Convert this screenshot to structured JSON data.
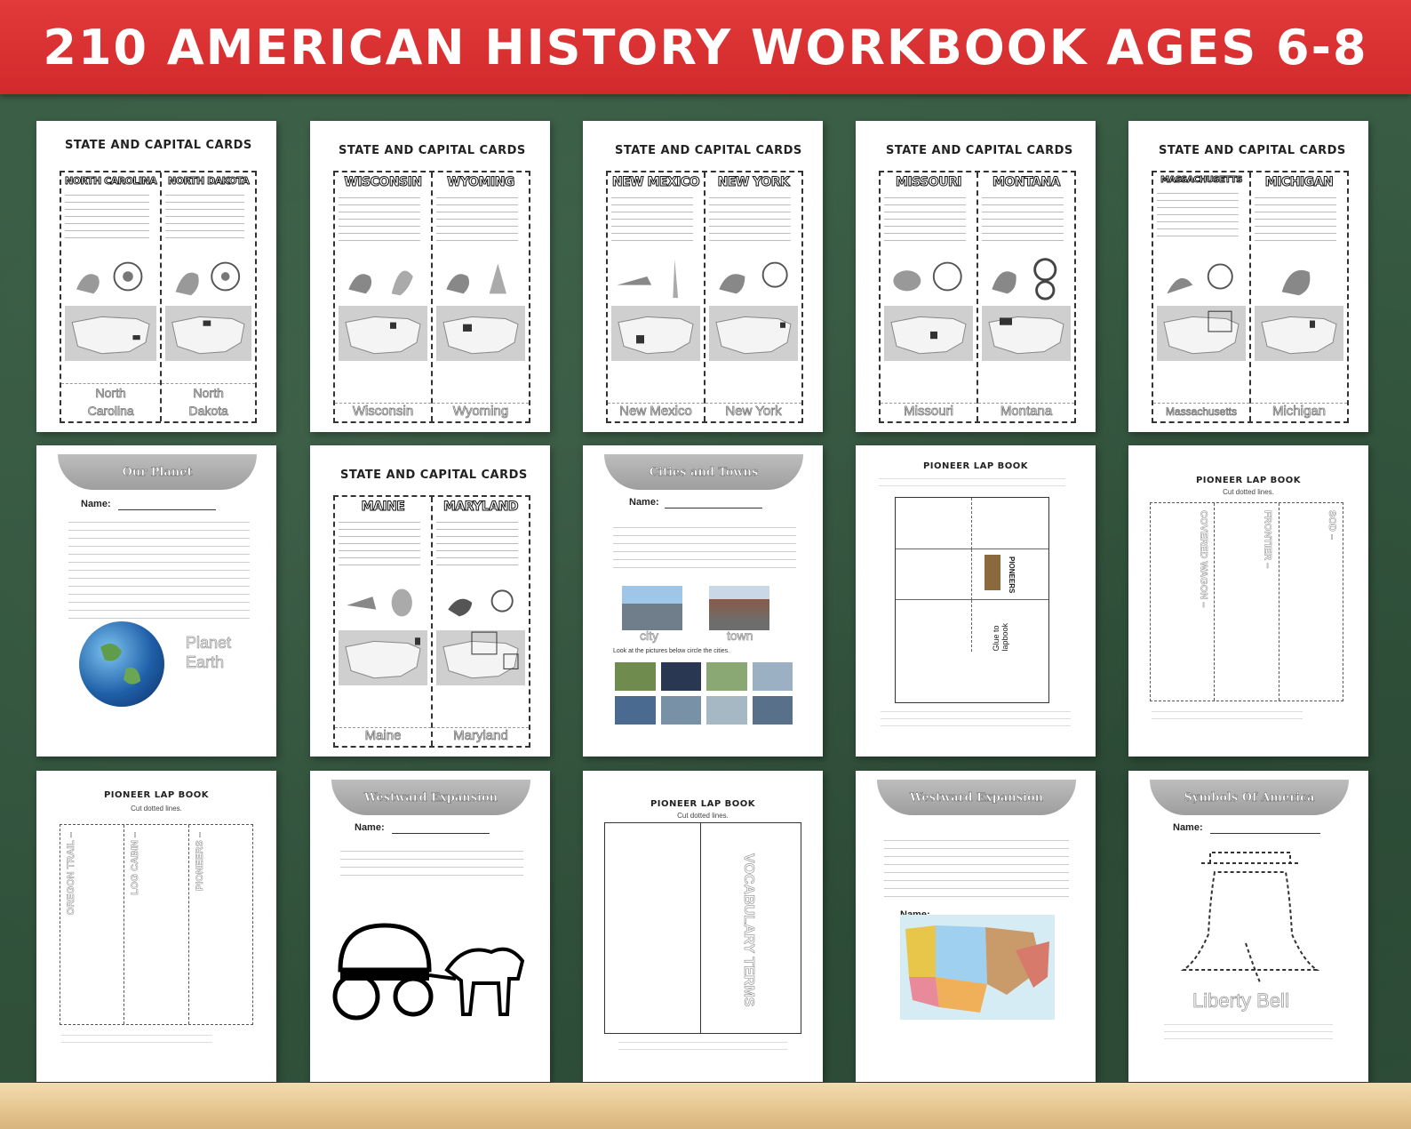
{
  "banner": {
    "title": "210 AMERICAN HISTORY WORKBOOK AGES 6-8"
  },
  "state_cards": [
    {
      "title": "STATE AND CAPITAL CARDS",
      "left": "NORTH CAROLINA",
      "right": "NORTH DAKOTA"
    },
    {
      "title": "STATE AND CAPITAL CARDS",
      "left": "WISCONSIN",
      "right": "WYOMING"
    },
    {
      "title": "STATE AND CAPITAL CARDS",
      "left": "NEW MEXICO",
      "right": "NEW YORK"
    },
    {
      "title": "STATE AND CAPITAL CARDS",
      "left": "MISSOURI",
      "right": "MONTANA"
    },
    {
      "title": "STATE AND CAPITAL CARDS",
      "left": "MASSACHUSETTS",
      "right": "MICHIGAN"
    },
    {
      "title": "STATE AND CAPITAL CARDS",
      "left": "MAINE",
      "right": "MARYLAND"
    }
  ],
  "traces": {
    "nc1": "North",
    "nc2": "Carolina",
    "nd1": "North",
    "nd2": "Dakota",
    "wi": "Wisconsin",
    "wy": "Wyoming",
    "nm": "New Mexico",
    "ny": "New York",
    "mo": "Missouri",
    "mt": "Montana",
    "ma": "Massachusetts",
    "mi": "Michigan",
    "me": "Maine",
    "md": "Maryland"
  },
  "our_planet": {
    "heading": "Our Planet",
    "name_label": "Name:",
    "trace1": "Planet",
    "trace2": "Earth"
  },
  "cities": {
    "heading": "Cities and Towns",
    "name_label": "Name:",
    "city": "city",
    "town": "town",
    "prompt": "Look at the pictures below circle the cities."
  },
  "lapbook1": {
    "title": "PIONEER LAP BOOK",
    "glue": "Glue to lapbook",
    "pioneers": "PIONEERS"
  },
  "lapbook2": {
    "title": "PIONEER LAP BOOK",
    "sub": "Cut dotted lines.",
    "t1": "SOD –",
    "t2": "FRONTIER –",
    "t3": "COVERED WAGON –"
  },
  "lapbook3": {
    "title": "PIONEER LAP BOOK",
    "sub": "Cut dotted lines.",
    "t1": "PIONEERS –",
    "t2": "LOG CABIN –",
    "t3": "OREGON TRAIL –"
  },
  "westward1": {
    "heading": "Westward Expansion",
    "name_label": "Name:"
  },
  "lapbook4": {
    "title": "PIONEER LAP BOOK",
    "sub": "Cut dotted lines.",
    "vocab": "VOCABULARY TERMS"
  },
  "westward2": {
    "heading": "Westward Expansion",
    "name_label": "Name:"
  },
  "symbols": {
    "heading": "Symbols Of America",
    "name_label": "Name:",
    "trace": "Liberty Bell"
  }
}
